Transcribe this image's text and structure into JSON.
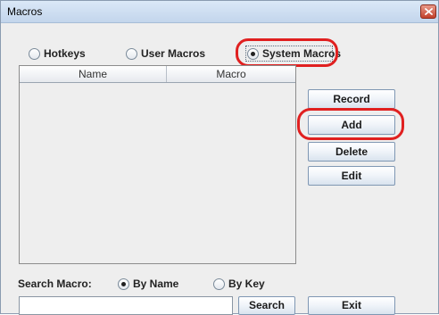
{
  "window": {
    "title": "Macros"
  },
  "macro_type": {
    "options": [
      {
        "label": "Hotkeys",
        "checked": false
      },
      {
        "label": "User Macros",
        "checked": false
      },
      {
        "label": "System Macros",
        "checked": true
      }
    ]
  },
  "table": {
    "columns": [
      "Name",
      "Macro"
    ],
    "rows": []
  },
  "buttons": {
    "record": "Record",
    "add": "Add",
    "delete": "Delete",
    "edit": "Edit",
    "search": "Search",
    "exit": "Exit"
  },
  "search": {
    "label": "Search Macro:",
    "by_name": {
      "label": "By Name",
      "checked": true
    },
    "by_key": {
      "label": "By Key",
      "checked": false
    },
    "value": ""
  },
  "colors": {
    "highlight": "#e02020",
    "window_bg": "#eeeeee",
    "button_border": "#7f97b3"
  }
}
